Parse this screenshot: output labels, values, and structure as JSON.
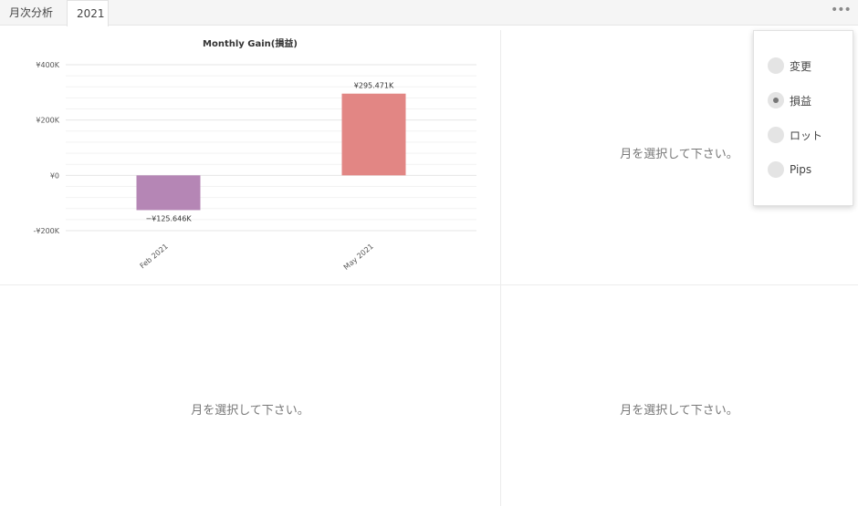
{
  "tabs": [
    {
      "label": "月次分析"
    },
    {
      "label": "2021"
    }
  ],
  "more_icon": "•••",
  "placeholders": {
    "top_right": "月を選択して下さい。",
    "bottom_left": "月を選択して下さい。",
    "bottom_right": "月を選択して下さい。"
  },
  "menu": {
    "items": [
      {
        "label": "変更",
        "selected": false
      },
      {
        "label": "損益",
        "selected": true
      },
      {
        "label": "ロット",
        "selected": false
      },
      {
        "label": "Pips",
        "selected": false
      }
    ]
  },
  "chart_data": {
    "type": "bar",
    "title": "Monthly Gain(損益)",
    "categories": [
      "Feb 2021",
      "May 2021"
    ],
    "values": [
      -125646,
      295471
    ],
    "data_labels": [
      "−¥125.646K",
      "¥295.471K"
    ],
    "colors": [
      "#b586b5",
      "#e28684"
    ],
    "ylim": [
      -200000,
      400000
    ],
    "yticks": [
      {
        "value": 400000,
        "label": "¥400K"
      },
      {
        "value": 200000,
        "label": "¥200K"
      },
      {
        "value": 0,
        "label": "¥0"
      },
      {
        "value": -200000,
        "label": "-¥200K"
      }
    ],
    "grid": true,
    "legend": "none"
  }
}
